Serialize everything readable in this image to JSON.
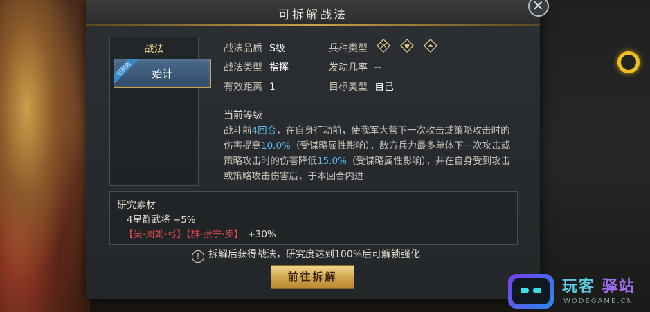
{
  "dialog": {
    "title": "可拆解战法",
    "close_icon": "close-icon"
  },
  "list": {
    "header": "战法",
    "items": [
      {
        "label": "始计",
        "badge": "已研究",
        "selected": true
      }
    ]
  },
  "info": {
    "quality_label": "战法品质",
    "quality_value": "S级",
    "type_label": "战法类型",
    "type_value": "指挥",
    "range_label": "有效距离",
    "range_value": "1",
    "unit_label": "兵种类型",
    "unit_icons": [
      "cavalry-icon",
      "shield-icon",
      "archer-icon"
    ],
    "rate_label": "发动几率",
    "rate_value": "--",
    "target_label": "目标类型",
    "target_value": "自己"
  },
  "level": {
    "title": "当前等级",
    "desc_parts": [
      "战斗前",
      "4回合",
      "，在自身行动前，使我军大营下一次攻击或策略攻击时的伤害提高",
      "10.0%",
      "（受谋略属性影响），敌方兵力最多单体下一次攻击或策略攻击时的伤害降低",
      "15.0%",
      "（受谋略属性影响），并在自身受到攻击或策略攻击伤害后，于本回合内进"
    ]
  },
  "materials": {
    "title": "研究素材",
    "line1": "4星群武将 +5%",
    "line2_items": [
      "【吴·周姬·弓】",
      "【群·张宁·步】"
    ],
    "line2_pct": "+30%"
  },
  "notice": "拆解后获得战法，研究度达到100%后可解锁强化",
  "button": "前往拆解",
  "watermark": {
    "title_a": "玩客",
    "title_b": "驿站",
    "sub": "WODEGAME.CN"
  },
  "colors": {
    "accent_gold": "#c8a44a",
    "highlight_blue": "#5cb8e8",
    "highlight_red": "#e04a4a"
  }
}
